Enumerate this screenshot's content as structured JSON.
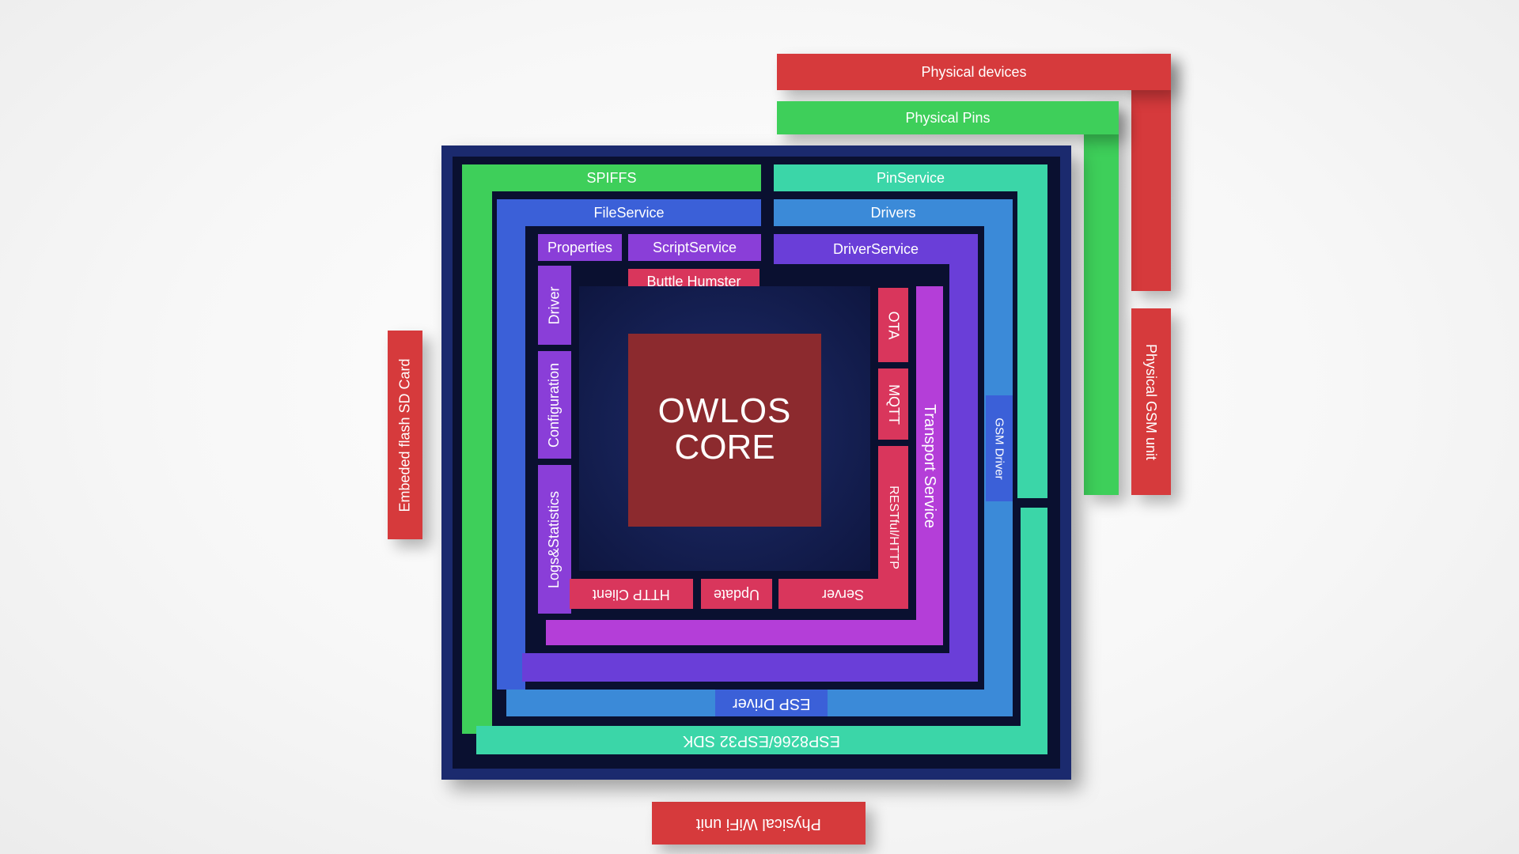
{
  "external": {
    "physical_devices": "Physical devices",
    "physical_pins": "Physical Pins",
    "physical_gsm": "Physical GSM unit",
    "sd_card": "Embeded flash SD Card",
    "wifi": "Physical WiFi unit"
  },
  "layers": {
    "spiffs": "SPIFFS",
    "pin_service": "PinService",
    "file_service": "FileService",
    "drivers": "Drivers",
    "properties": "Properties",
    "script_service": "ScriptService",
    "driver_service": "DriverService",
    "buttle_humster": "Buttle Humster",
    "driver": "Driver",
    "configuration": "Configuration",
    "logs_statistics": "Logs&Statistics",
    "ota": "OTA",
    "mqtt": "MQTT",
    "rest_http": "RESTful/HTTP",
    "transport_service": "Transport Service",
    "gsm_driver": "GSM Driver",
    "http_client": "HTTP Client",
    "update": "Update",
    "server": "Server",
    "esp_driver": "ESP Driver",
    "sdk": "ESP8266/ESP32 SDK"
  },
  "core": {
    "line1": "OWLOS",
    "line2": "CORE"
  },
  "colors": {
    "red": "#d63a3c",
    "crimson": "#d9365c",
    "green": "#3ecf5a",
    "teal": "#3bd6a8",
    "blue": "#3b60d8",
    "light_blue": "#3b8ad8",
    "purple": "#6a3ed8",
    "magenta": "#b43ed8",
    "core": "#8c2a2e",
    "frame": "#1b2a6e"
  }
}
